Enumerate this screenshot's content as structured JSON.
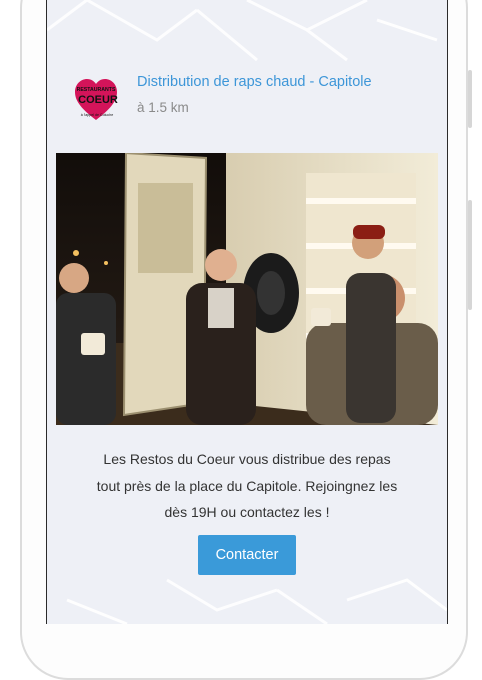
{
  "card": {
    "title": "Distribution de raps chaud - Capitole",
    "distance": "à 1.5 km",
    "logo_text_top": "RESTAURANTS",
    "logo_text_main": "COEUR",
    "logo_text_sub": "à l'appel de Coluche",
    "description_lines": [
      "Les Restos du Coeur vous distribue des repas",
      "tout près de la place du Capitole. Rejoingnez les",
      "dès 19H ou contactez les !"
    ],
    "button_label": "Contacter"
  },
  "colors": {
    "accent": "#3a9ad9",
    "title": "#3d96d8",
    "background": "#eef0f6",
    "logo_pink": "#d4145a"
  },
  "icons": [
    "restos-du-coeur-logo"
  ]
}
